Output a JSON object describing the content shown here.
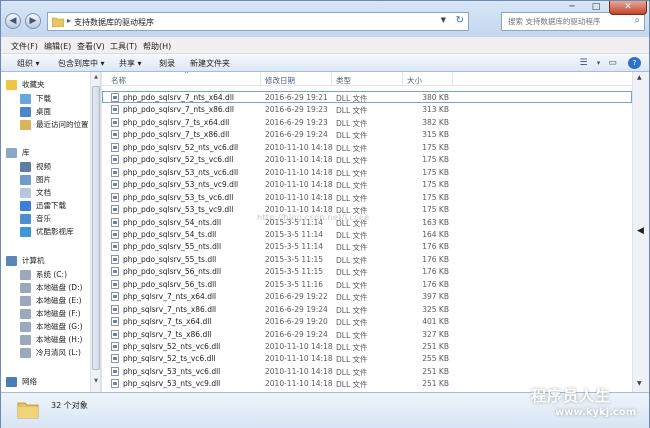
{
  "window": {
    "minimize": "─",
    "maximize": "□",
    "close": "✕"
  },
  "address": {
    "crumb": "支持数据库的驱动程序",
    "separator": "▸",
    "refresh": "↻",
    "back": "◀",
    "forward": "▶"
  },
  "search": {
    "placeholder": "搜索 支持数据库的驱动程序"
  },
  "menu": [
    "文件(F)",
    "编辑(E)",
    "查看(V)",
    "工具(T)",
    "帮助(H)"
  ],
  "toolbar": {
    "organize": "组织 ▾",
    "include": "包含到库中 ▾",
    "share": "共享 ▾",
    "burn": "刻录",
    "new_folder": "新建文件夹",
    "help": "?"
  },
  "nav": {
    "favorites": "收藏夹",
    "downloads": "下载",
    "desktop": "桌面",
    "recent": "最近访问的位置",
    "libraries": "库",
    "videos": "视频",
    "pictures": "图片",
    "documents": "文档",
    "thunder": "迅雷下载",
    "music": "音乐",
    "youku": "优酷影视库",
    "computer": "计算机",
    "system_c": "系统 (C:)",
    "disk_d": "本地磁盘 (D:)",
    "disk_e": "本地磁盘 (E:)",
    "disk_f": "本地磁盘 (F:)",
    "disk_g": "本地磁盘 (G:)",
    "disk_h": "本地磁盘 (H:)",
    "disk_l": "冷月清风 (L:)",
    "network": "网络"
  },
  "columns": {
    "name": "名称",
    "date": "修改日期",
    "type": "类型",
    "size": "大小"
  },
  "files": [
    {
      "name": "php_pdo_sqlsrv_7_nts_x64.dll",
      "date": "2016-6-29 19:21",
      "type": "DLL 文件",
      "size": "380 KB"
    },
    {
      "name": "php_pdo_sqlsrv_7_nts_x86.dll",
      "date": "2016-6-29 19:23",
      "type": "DLL 文件",
      "size": "313 KB"
    },
    {
      "name": "php_pdo_sqlsrv_7_ts_x64.dll",
      "date": "2016-6-29 19:23",
      "type": "DLL 文件",
      "size": "382 KB"
    },
    {
      "name": "php_pdo_sqlsrv_7_ts_x86.dll",
      "date": "2016-6-29 19:24",
      "type": "DLL 文件",
      "size": "315 KB"
    },
    {
      "name": "php_pdo_sqlsrv_52_nts_vc6.dll",
      "date": "2010-11-10 14:18",
      "type": "DLL 文件",
      "size": "175 KB"
    },
    {
      "name": "php_pdo_sqlsrv_52_ts_vc6.dll",
      "date": "2010-11-10 14:18",
      "type": "DLL 文件",
      "size": "175 KB"
    },
    {
      "name": "php_pdo_sqlsrv_53_nts_vc6.dll",
      "date": "2010-11-10 14:18",
      "type": "DLL 文件",
      "size": "175 KB"
    },
    {
      "name": "php_pdo_sqlsrv_53_nts_vc9.dll",
      "date": "2010-11-10 14:18",
      "type": "DLL 文件",
      "size": "175 KB"
    },
    {
      "name": "php_pdo_sqlsrv_53_ts_vc6.dll",
      "date": "2010-11-10 14:18",
      "type": "DLL 文件",
      "size": "175 KB"
    },
    {
      "name": "php_pdo_sqlsrv_53_ts_vc9.dll",
      "date": "2010-11-10 14:18",
      "type": "DLL 文件",
      "size": "175 KB"
    },
    {
      "name": "php_pdo_sqlsrv_54_nts.dll",
      "date": "2015-3-5 11:14",
      "type": "DLL 文件",
      "size": "163 KB"
    },
    {
      "name": "php_pdo_sqlsrv_54_ts.dll",
      "date": "2015-3-5 11:14",
      "type": "DLL 文件",
      "size": "164 KB"
    },
    {
      "name": "php_pdo_sqlsrv_55_nts.dll",
      "date": "2015-3-5 11:14",
      "type": "DLL 文件",
      "size": "176 KB"
    },
    {
      "name": "php_pdo_sqlsrv_55_ts.dll",
      "date": "2015-3-5 11:15",
      "type": "DLL 文件",
      "size": "176 KB"
    },
    {
      "name": "php_pdo_sqlsrv_56_nts.dll",
      "date": "2015-3-5 11:15",
      "type": "DLL 文件",
      "size": "176 KB"
    },
    {
      "name": "php_pdo_sqlsrv_56_ts.dll",
      "date": "2015-3-5 11:16",
      "type": "DLL 文件",
      "size": "176 KB"
    },
    {
      "name": "php_sqlsrv_7_nts_x64.dll",
      "date": "2016-6-29 19:22",
      "type": "DLL 文件",
      "size": "397 KB"
    },
    {
      "name": "php_sqlsrv_7_nts_x86.dll",
      "date": "2016-6-29 19:24",
      "type": "DLL 文件",
      "size": "325 KB"
    },
    {
      "name": "php_sqlsrv_7_ts_x64.dll",
      "date": "2016-6-29 19:20",
      "type": "DLL 文件",
      "size": "401 KB"
    },
    {
      "name": "php_sqlsrv_7_ts_x86.dll",
      "date": "2016-6-29 19:24",
      "type": "DLL 文件",
      "size": "327 KB"
    },
    {
      "name": "php_sqlsrv_52_nts_vc6.dll",
      "date": "2010-11-10 14:18",
      "type": "DLL 文件",
      "size": "251 KB"
    },
    {
      "name": "php_sqlsrv_52_ts_vc6.dll",
      "date": "2010-11-10 14:18",
      "type": "DLL 文件",
      "size": "255 KB"
    },
    {
      "name": "php_sqlsrv_53_nts_vc6.dll",
      "date": "2010-11-10 14:18",
      "type": "DLL 文件",
      "size": "251 KB"
    },
    {
      "name": "php_sqlsrv_53_nts_vc9.dll",
      "date": "2010-11-10 14:18",
      "type": "DLL 文件",
      "size": "251 KB"
    }
  ],
  "status": {
    "count": "32 个对象"
  },
  "overlay": {
    "watermark": "http://blog.csdn.net/Lccee",
    "brand": "程序员人生",
    "brand_url": "www.kykj.com"
  },
  "scroll": {
    "up": "▲",
    "down": "▼",
    "side": "◀",
    "search_glyph": "⌕"
  },
  "colors": {
    "accent": "#2f6fcf",
    "selection_border": "#7da2ce",
    "close": "#c2452c"
  }
}
